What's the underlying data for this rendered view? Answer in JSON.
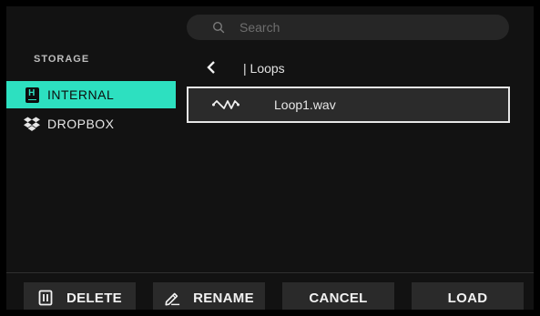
{
  "search": {
    "placeholder": "Search",
    "icon": "search-icon"
  },
  "sidebar": {
    "title": "STORAGE",
    "accent": "#2de0c0",
    "items": [
      {
        "label": "INTERNAL",
        "icon": "internal-storage-icon",
        "selected": true
      },
      {
        "label": "DROPBOX",
        "icon": "dropbox-icon",
        "selected": false
      }
    ]
  },
  "browser": {
    "back_icon": "chevron-left-icon",
    "path": "| Loops",
    "files": [
      {
        "name": "Loop1.wav",
        "icon": "waveform-icon",
        "selected": true
      }
    ]
  },
  "actions": {
    "delete_label": "DELETE",
    "rename_label": "RENAME",
    "cancel_label": "CANCEL",
    "load_label": "LOAD"
  }
}
